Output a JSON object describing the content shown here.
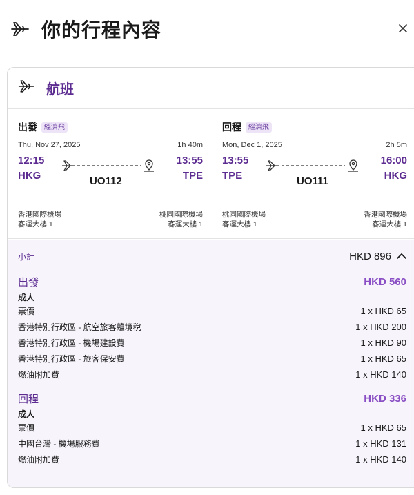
{
  "header": {
    "title": "你的行程內容",
    "close_label": "×"
  },
  "card": {
    "title": "航班"
  },
  "outbound": {
    "direction": "出發",
    "cabin": "經濟飛",
    "date": "Thu, Nov 27, 2025",
    "duration": "1h 40m",
    "depart_time": "12:15",
    "depart_code": "HKG",
    "arrive_time": "13:55",
    "arrive_code": "TPE",
    "flight_no": "UO112",
    "depart_airport": "香港國際機場",
    "depart_terminal": "客運大樓 1",
    "arrive_airport": "桃園國際機場",
    "arrive_terminal": "客運大樓 1"
  },
  "return": {
    "direction": "回程",
    "cabin": "經濟飛",
    "date": "Mon, Dec 1, 2025",
    "duration": "2h 5m",
    "depart_time": "13:55",
    "depart_code": "TPE",
    "arrive_time": "16:00",
    "arrive_code": "HKG",
    "flight_no": "UO111",
    "depart_airport": "桃園國際機場",
    "depart_terminal": "客運大樓 1",
    "arrive_airport": "香港國際機場",
    "arrive_terminal": "客運大樓 1"
  },
  "summary": {
    "subtotal_label": "小計",
    "subtotal_amount": "HKD 896",
    "outbound": {
      "label": "出發",
      "amount": "HKD 560",
      "passenger": "成人",
      "items": [
        {
          "name": "票價",
          "amount": "1 x HKD 65"
        },
        {
          "name": "香港特別行政區 - 航空旅客離境稅",
          "amount": "1 x HKD 200"
        },
        {
          "name": "香港特別行政區 - 機場建設費",
          "amount": "1 x HKD 90"
        },
        {
          "name": "香港特別行政區 - 旅客保安費",
          "amount": "1 x HKD 65"
        },
        {
          "name": "燃油附加費",
          "amount": "1 x HKD 140"
        }
      ]
    },
    "return": {
      "label": "回程",
      "amount": "HKD 336",
      "passenger": "成人",
      "items": [
        {
          "name": "票價",
          "amount": "1 x HKD 65"
        },
        {
          "name": "中國台灣 - 機場服務費",
          "amount": "1 x HKD 131"
        },
        {
          "name": "燃油附加費",
          "amount": "1 x HKD 140"
        }
      ]
    }
  }
}
